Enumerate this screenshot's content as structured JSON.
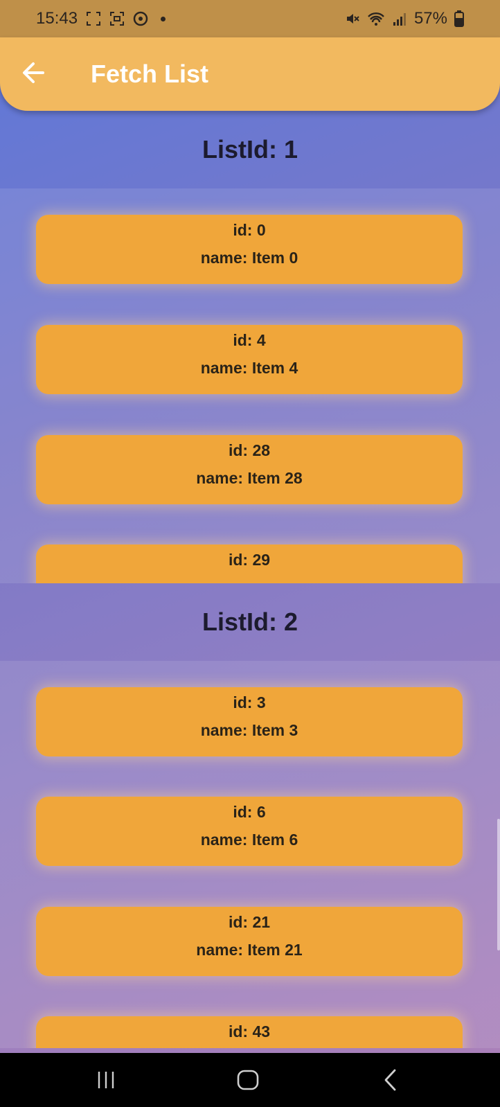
{
  "status_bar": {
    "time": "15:43",
    "battery": "57%",
    "icons": [
      "screenshot-icon",
      "screen-record-icon",
      "sync-icon",
      "notification-dot",
      "mute-icon",
      "wifi-icon",
      "signal-icon",
      "battery-icon"
    ]
  },
  "app_bar": {
    "title": "Fetch List",
    "back_icon": "arrow-left-icon",
    "background": "#f2b95f"
  },
  "sections": [
    {
      "header": "ListId: 1",
      "items": [
        {
          "id": "id: 0",
          "name": "name: Item 0"
        },
        {
          "id": "id: 4",
          "name": "name: Item 4"
        },
        {
          "id": "id: 28",
          "name": "name: Item 28"
        },
        {
          "id": "id: 29",
          "name": ""
        }
      ]
    },
    {
      "header": "ListId: 2",
      "items": [
        {
          "id": "id: 3",
          "name": "name: Item 3"
        },
        {
          "id": "id: 6",
          "name": "name: Item 6"
        },
        {
          "id": "id: 21",
          "name": "name: Item 21"
        },
        {
          "id": "id: 43",
          "name": ""
        }
      ]
    }
  ],
  "card_color": "#f0a63a",
  "nav_bar": {
    "buttons": [
      "recents-icon",
      "home-icon",
      "back-nav-icon"
    ]
  }
}
